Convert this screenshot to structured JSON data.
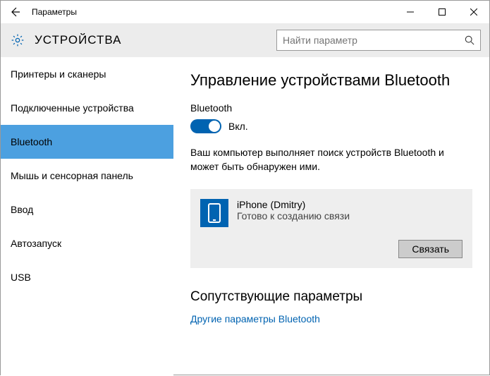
{
  "window": {
    "title": "Параметры"
  },
  "header": {
    "title": "УСТРОЙСТВА",
    "search_placeholder": "Найти параметр"
  },
  "sidebar": {
    "items": [
      {
        "label": "Принтеры и сканеры"
      },
      {
        "label": "Подключенные устройства"
      },
      {
        "label": "Bluetooth"
      },
      {
        "label": "Мышь и сенсорная панель"
      },
      {
        "label": "Ввод"
      },
      {
        "label": "Автозапуск"
      },
      {
        "label": "USB"
      }
    ]
  },
  "content": {
    "page_title": "Управление устройствами Bluetooth",
    "bluetooth_label": "Bluetooth",
    "toggle_state": "Вкл.",
    "description": "Ваш компьютер выполняет поиск устройств Bluetooth и может быть обнаружен ими.",
    "device": {
      "name": "iPhone (Dmitry)",
      "status": "Готово к созданию связи",
      "pair_button": "Связать"
    },
    "related_title": "Сопутствующие параметры",
    "related_link": "Другие параметры Bluetooth"
  }
}
